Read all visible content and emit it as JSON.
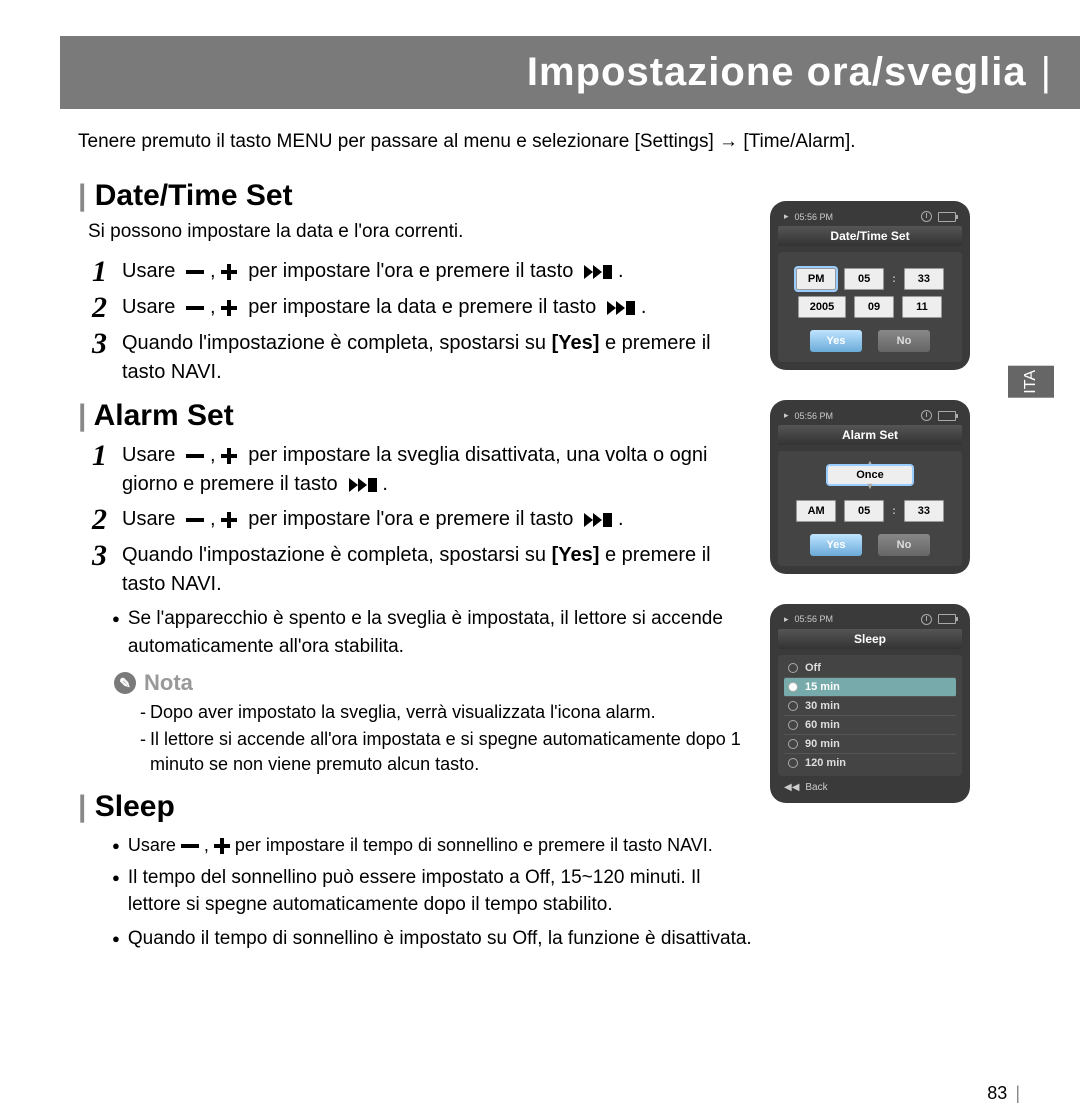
{
  "banner": {
    "title": "Impostazione ora/sveglia"
  },
  "intro": "Tenere premuto il tasto MENU per passare al menu e selezionare [Settings] → [Time/Alarm].",
  "sections": {
    "datetime": {
      "heading": "Date/Time Set",
      "sub": "Si possono impostare la data e l'ora correnti.",
      "steps": [
        "Usare",
        "per impostare l'ora e premere il tasto",
        "Usare",
        "per impostare la data e premere il tasto",
        "Quando l'impostazione è completa, spostarsi su",
        "Yes",
        "e premere il tasto NAVI."
      ]
    },
    "alarm": {
      "heading": "Alarm Set",
      "steps_a": [
        "Usare",
        "per impostare la sveglia disattivata, una volta o ogni giorno e premere il tasto",
        "Usare",
        "per impostare l'ora e premere il tasto",
        "Quando l'impostazione è completa, spostarsi su",
        "Yes",
        "e premere il tasto NAVI."
      ],
      "bullet": "Se l'apparecchio è spento e la sveglia è impostata, il lettore si accende automaticamente all'ora stabilita.",
      "nota_label": "Nota",
      "nota_items": [
        "Dopo aver impostato la sveglia, verrà visualizzata l'icona alarm.",
        "Il lettore si accende all'ora impostata e si spegne automaticamente dopo 1 minuto se non viene premuto alcun tasto."
      ]
    },
    "sleep": {
      "heading": "Sleep",
      "bullets": [
        "Usare  per impostare il tempo di sonnellino e premere il tasto NAVI.",
        "Il tempo del sonnellino può essere impostato a Off, 15~120 minuti. Il lettore si spegne automaticamente dopo il tempo stabilito.",
        "Quando il tempo di sonnellino è impostato su Off, la funzione è disattivata."
      ]
    }
  },
  "tab": "ITA",
  "pagenum": "83",
  "device": {
    "status_time": "05:56 PM",
    "datetime": {
      "title": "Date/Time Set",
      "ampm": "PM",
      "hh": "05",
      "mm": "33",
      "yyyy": "2005",
      "mo": "09",
      "dd": "11",
      "yes": "Yes",
      "no": "No"
    },
    "alarm": {
      "title": "Alarm Set",
      "mode": "Once",
      "ampm": "AM",
      "hh": "05",
      "mm": "33",
      "yes": "Yes",
      "no": "No"
    },
    "sleep": {
      "title": "Sleep",
      "items": [
        "Off",
        "15 min",
        "30 min",
        "60 min",
        "90 min",
        "120 min"
      ],
      "back": "Back"
    }
  }
}
